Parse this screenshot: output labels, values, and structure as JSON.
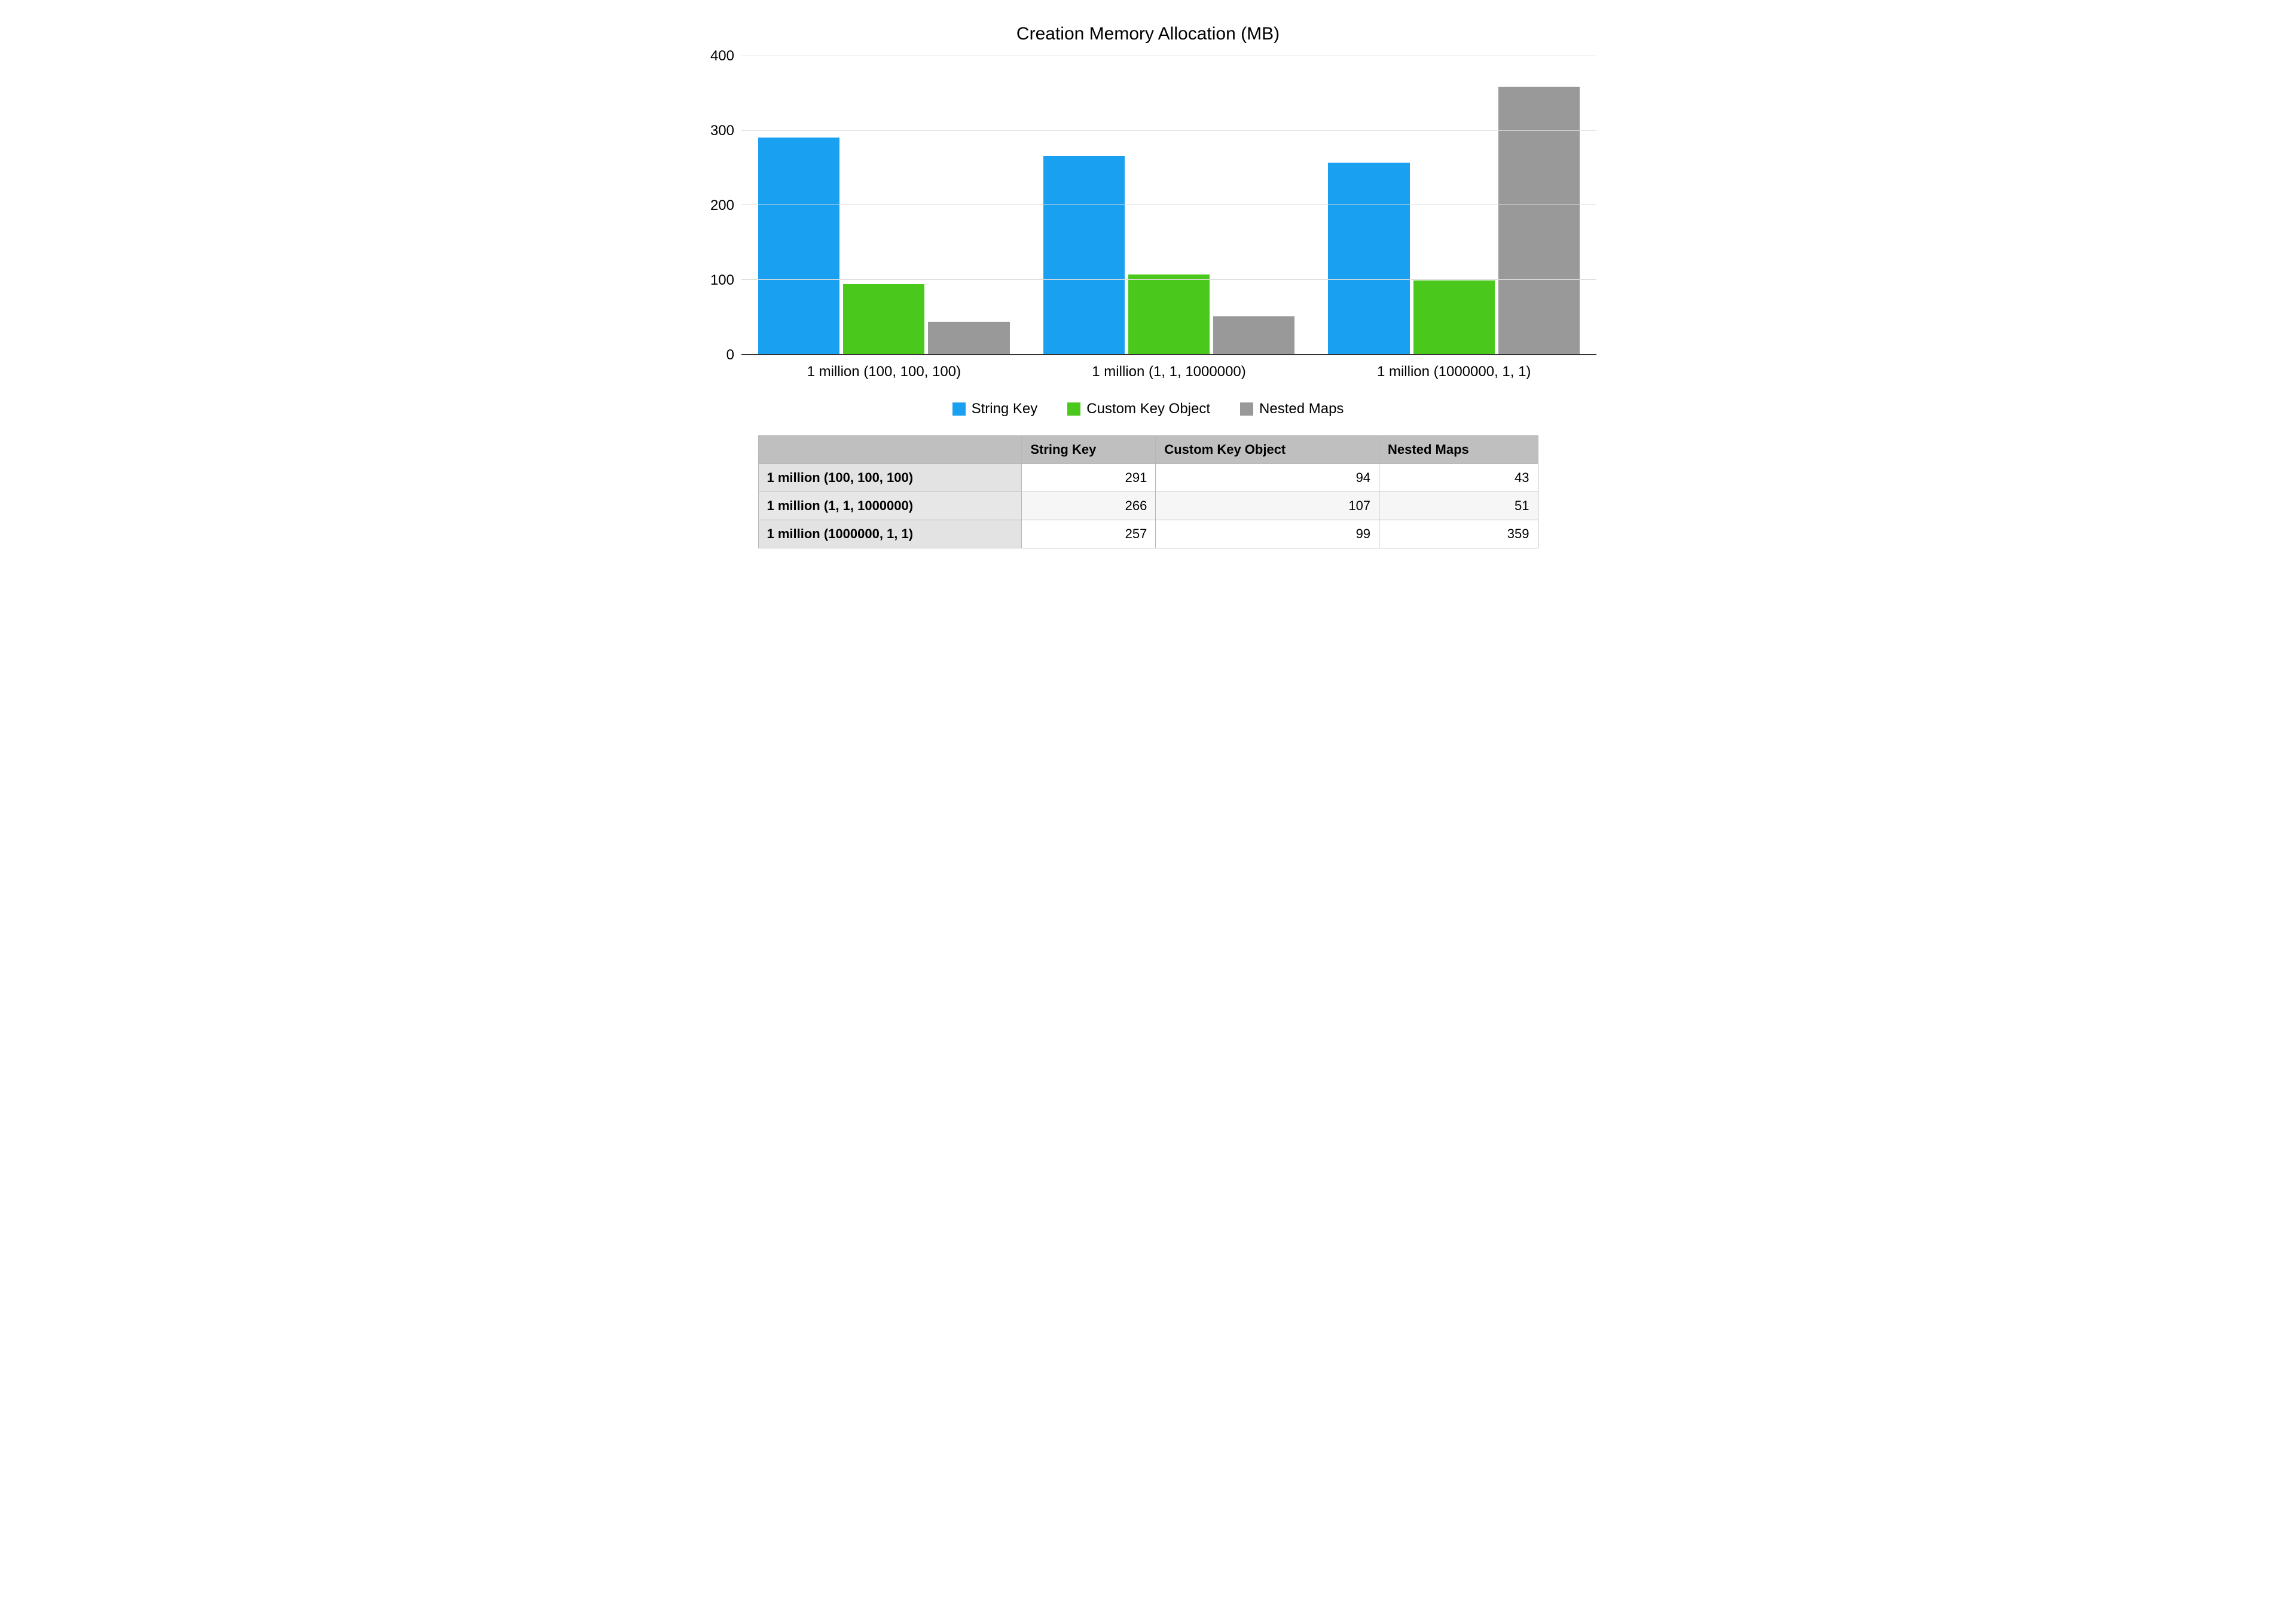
{
  "chart_data": {
    "type": "bar",
    "title": "Creation Memory Allocation (MB)",
    "categories": [
      "1 million (100, 100, 100)",
      "1 million (1, 1, 1000000)",
      "1 million (1000000, 1, 1)"
    ],
    "series": [
      {
        "name": "String Key",
        "values": [
          291,
          266,
          257
        ],
        "color": "#1aa0f0"
      },
      {
        "name": "Custom Key Object",
        "values": [
          94,
          107,
          99
        ],
        "color": "#4bc81c"
      },
      {
        "name": "Nested Maps",
        "values": [
          43,
          51,
          359
        ],
        "color": "#999999"
      }
    ],
    "ylim": [
      0,
      400
    ],
    "yticks": [
      0,
      100,
      200,
      300,
      400
    ],
    "xlabel": "",
    "ylabel": ""
  },
  "legend": {
    "items": [
      "String Key",
      "Custom Key Object",
      "Nested Maps"
    ]
  },
  "table": {
    "headers": [
      "String Key",
      "Custom Key Object",
      "Nested Maps"
    ],
    "rows": [
      {
        "label": "1 million (100, 100, 100)",
        "values": [
          291,
          94,
          43
        ]
      },
      {
        "label": "1 million (1, 1, 1000000)",
        "values": [
          266,
          107,
          51
        ]
      },
      {
        "label": "1 million (1000000, 1, 1)",
        "values": [
          257,
          99,
          359
        ]
      }
    ]
  }
}
